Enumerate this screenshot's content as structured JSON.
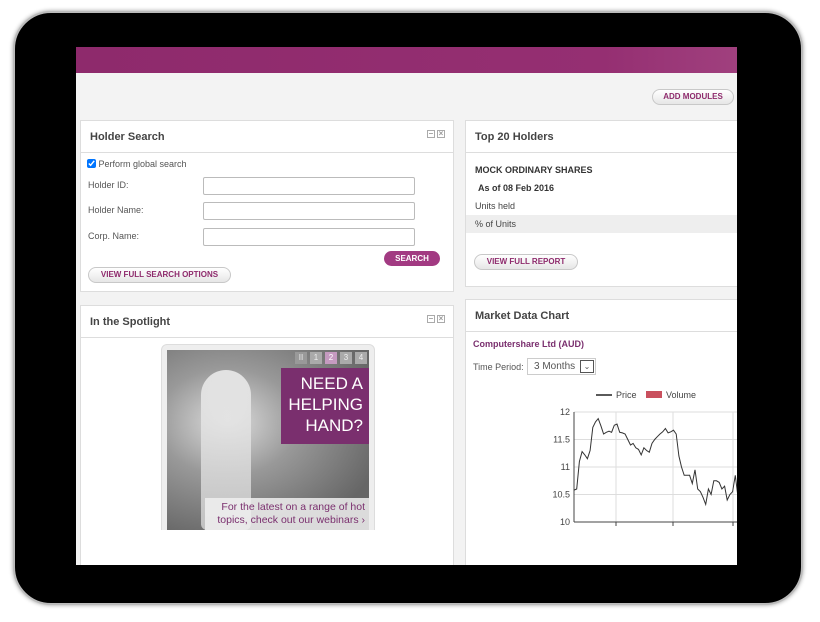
{
  "toolbar": {
    "add_modules": "ADD MODULES"
  },
  "holder_search": {
    "title": "Holder Search",
    "global_search": "Perform global search",
    "global_checked": true,
    "holder_id_label": "Holder ID:",
    "holder_id_value": "",
    "holder_name_label": "Holder Name:",
    "holder_name_value": "",
    "corp_name_label": "Corp. Name:",
    "corp_name_value": "",
    "search_button": "SEARCH",
    "full_options_button": "VIEW FULL SEARCH OPTIONS"
  },
  "spotlight": {
    "title": "In the Spotlight",
    "pager": [
      "II",
      "1",
      "2",
      "3",
      "4"
    ],
    "active_page": "2",
    "headline": [
      "NEED A",
      "HELPING",
      "HAND?"
    ],
    "caption": [
      "For the latest on a range of hot",
      "topics, check out our webinars ›"
    ]
  },
  "top_holders": {
    "title": "Top 20 Holders",
    "security": "MOCK ORDINARY SHARES",
    "as_of": "As of 08 Feb 2016",
    "rows": [
      "Units held",
      "% of Units"
    ],
    "report_button": "VIEW FULL REPORT"
  },
  "market_chart": {
    "title": "Market Data Chart",
    "company": "Computershare Ltd (AUD)",
    "period_label": "Time Period:",
    "period_value": "3 Months"
  },
  "colors": {
    "brand": "#8e2a6c",
    "volume": "#c9505e"
  },
  "chart_data": {
    "type": "line",
    "legend": [
      {
        "name": "Price",
        "color": "#222"
      },
      {
        "name": "Volume",
        "color": "#c9505e"
      }
    ],
    "legend_placement": "top",
    "ylim": [
      10,
      12
    ],
    "yticks": [
      "12",
      "11.5",
      "11",
      "10.5",
      "10"
    ],
    "grid": true,
    "series": [
      {
        "name": "Price",
        "values": [
          10.58,
          10.6,
          11.1,
          11.28,
          11.22,
          11.15,
          11.3,
          11.72,
          11.82,
          11.88,
          11.75,
          11.6,
          11.63,
          11.65,
          11.63,
          11.76,
          11.78,
          11.63,
          11.62,
          11.6,
          11.5,
          11.4,
          11.43,
          11.35,
          11.32,
          11.22,
          11.35,
          11.3,
          11.27,
          11.43,
          11.5,
          11.55,
          11.6,
          11.64,
          11.7,
          11.62,
          11.64,
          11.67,
          11.6,
          11.2,
          11.0,
          10.85,
          10.85,
          10.85,
          10.7,
          10.95,
          10.6,
          10.55,
          10.45,
          10.32,
          10.6,
          10.5,
          10.75,
          10.75,
          10.72,
          10.6,
          10.65,
          10.4,
          10.5,
          10.55,
          10.85,
          10.45
        ]
      }
    ]
  }
}
